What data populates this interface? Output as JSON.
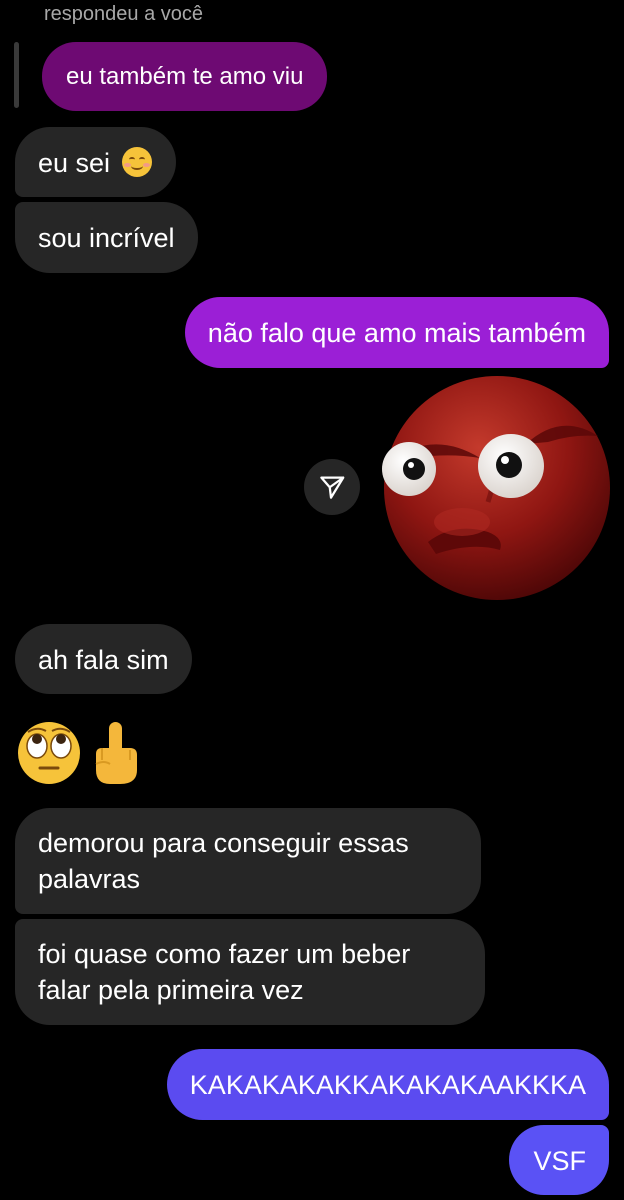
{
  "reply": {
    "header": "respondeu a você",
    "quoted_text": "eu também te amo viu"
  },
  "messages": {
    "recv_1": "eu sei",
    "recv_1_emoji": "smiling-face-icon",
    "recv_2": "sou incrível",
    "sent_1": "não falo que amo mais também",
    "sticker": "angry-red-face-sticker",
    "recv_3": "ah fala sim",
    "recv_emojis": [
      "face-with-rolling-eyes-icon",
      "middle-finger-icon"
    ],
    "recv_4": "demorou para conseguir essas palavras",
    "recv_5": "foi quase como fazer um beber falar pela primeira vez",
    "sent_2": "KAKAKAKAKKAKAKAKAAKKKA",
    "sent_3": "VSF"
  },
  "colors": {
    "background": "#000000",
    "received_bubble": "#262626",
    "reply_quote": "#6e0a73",
    "sent_purple": "#9b1fd6",
    "sent_violet": "#5b4bf0",
    "sent_blue": "#5a52f5"
  }
}
